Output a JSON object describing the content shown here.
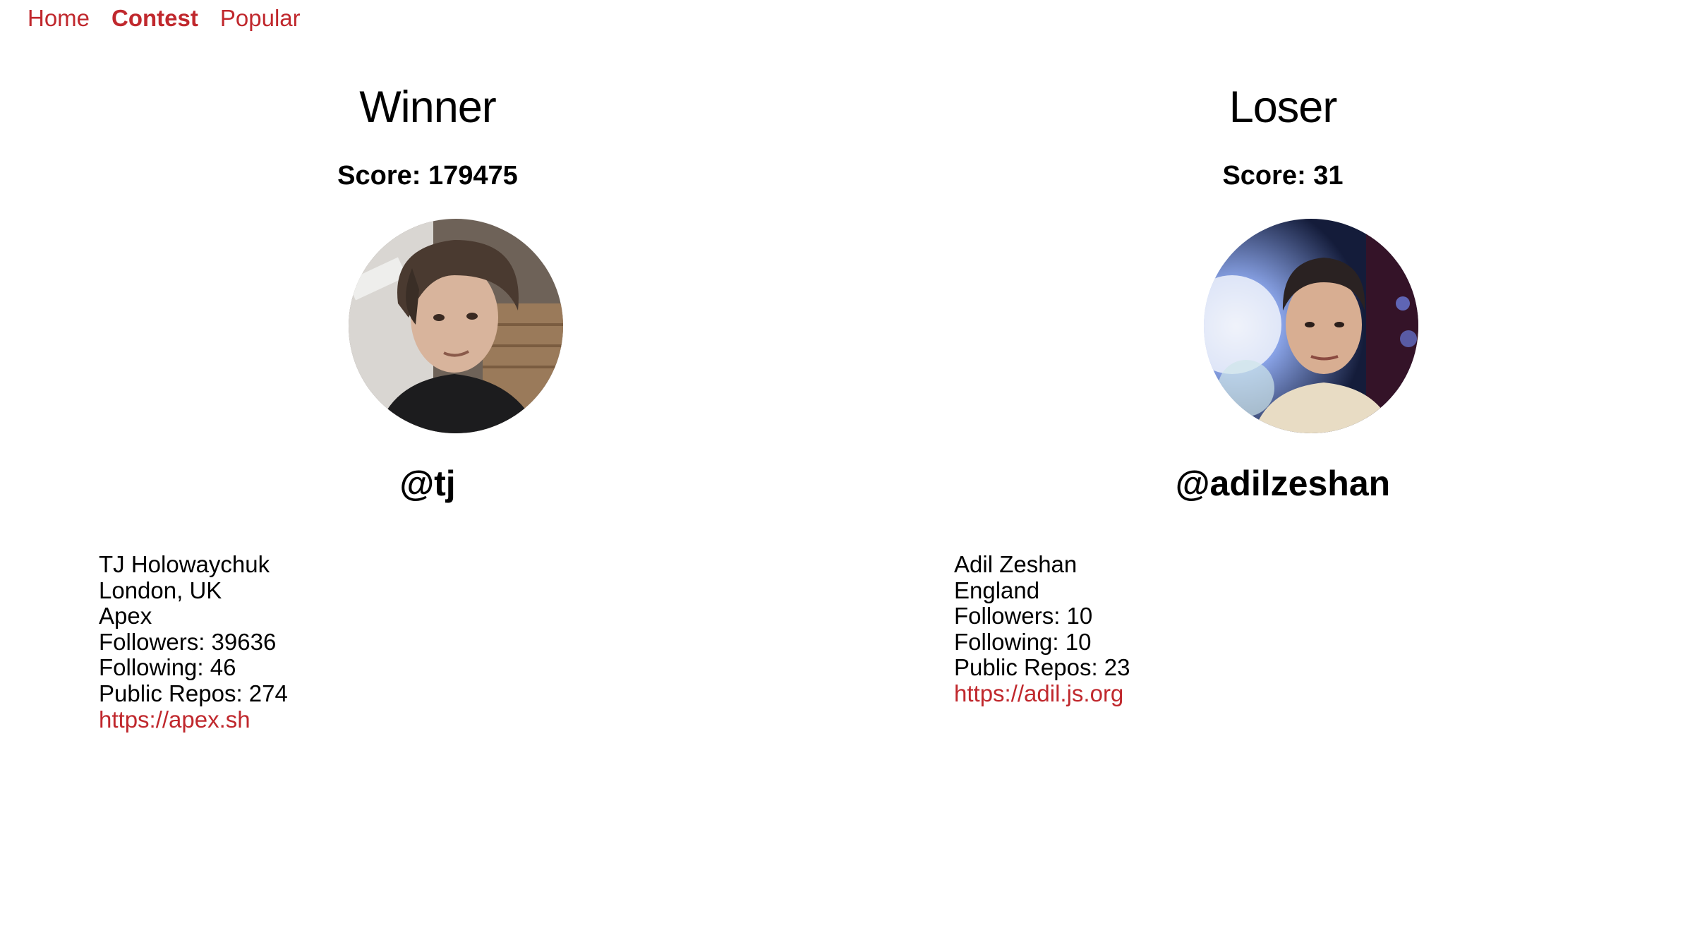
{
  "nav": {
    "home": "Home",
    "contest": "Contest",
    "popular": "Popular"
  },
  "winner": {
    "heading": "Winner",
    "score": "Score: 179475",
    "login": "@tj",
    "name": "TJ Holowaychuk",
    "location": "London, UK",
    "company": "Apex",
    "followers": "Followers: 39636",
    "following": "Following: 46",
    "public_repos": "Public Repos: 274",
    "blog": "https://apex.sh"
  },
  "loser": {
    "heading": "Loser",
    "score": "Score: 31",
    "login": "@adilzeshan",
    "name": "Adil Zeshan",
    "location": "England",
    "followers": "Followers: 10",
    "following": "Following: 10",
    "public_repos": "Public Repos: 23",
    "blog": "https://adil.js.org"
  },
  "colors": {
    "link": "#c0282d",
    "text": "#000000",
    "background": "#ffffff"
  }
}
